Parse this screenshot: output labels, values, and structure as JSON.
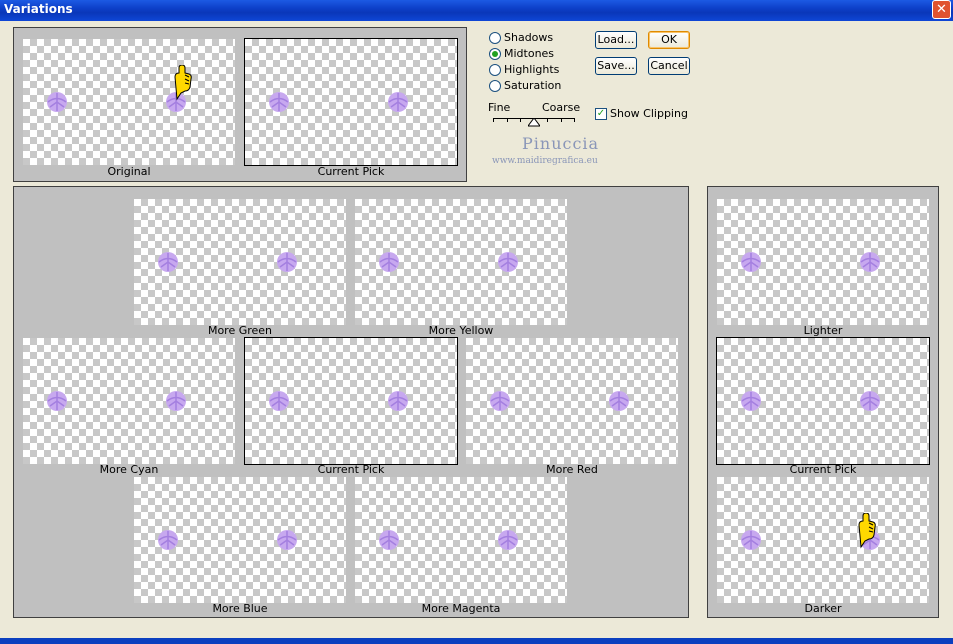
{
  "window": {
    "title": "Variations",
    "close_glyph": "✕"
  },
  "top": {
    "original_caption": "Original",
    "current_pick_caption": "Current Pick"
  },
  "tones": {
    "options": [
      "Shadows",
      "Midtones",
      "Highlights",
      "Saturation"
    ],
    "selected": "Midtones"
  },
  "buttons": {
    "load": "Load...",
    "ok": "OK",
    "save": "Save...",
    "cancel": "Cancel"
  },
  "slider": {
    "left_label": "Fine",
    "right_label": "Coarse"
  },
  "show_clipping": {
    "label": "Show Clipping",
    "checked": true
  },
  "watermark": {
    "name": "Pinuccia",
    "url": "www.maidiregrafica.eu"
  },
  "color_grid": {
    "more_green": "More Green",
    "more_yellow": "More Yellow",
    "more_cyan": "More Cyan",
    "current_pick": "Current Pick",
    "more_red": "More Red",
    "more_blue": "More Blue",
    "more_magenta": "More Magenta"
  },
  "brightness": {
    "lighter": "Lighter",
    "current_pick": "Current Pick",
    "darker": "Darker"
  },
  "colors": {
    "gem": "#c7a8ef",
    "gem_dark": "#a47fe0",
    "hand": "#ffd800"
  }
}
